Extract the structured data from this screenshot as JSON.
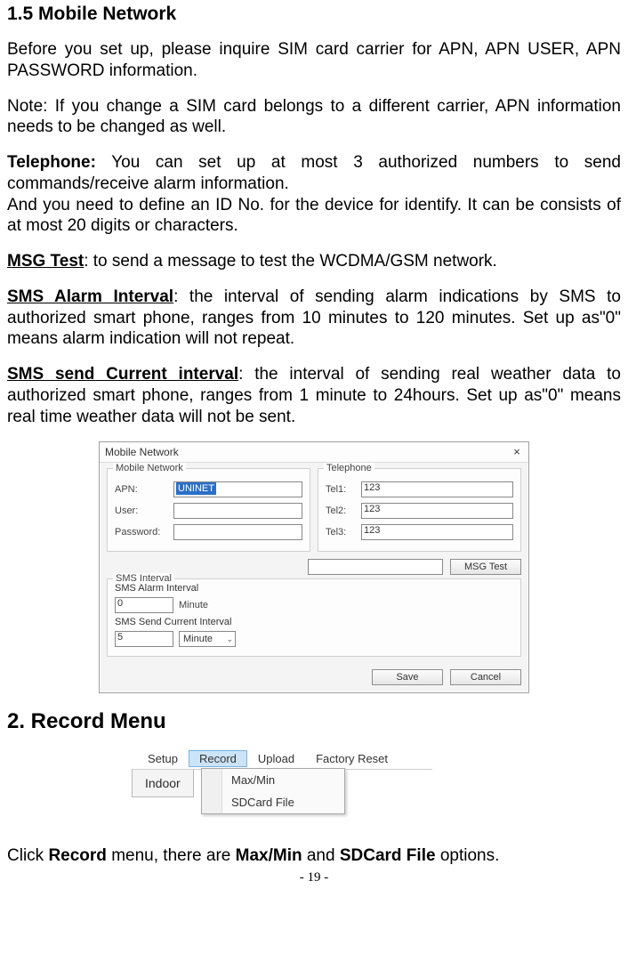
{
  "section15": {
    "heading": "1.5 Mobile Network",
    "p1": "Before you set up, please inquire SIM card carrier for APN, APN USER, APN PASSWORD information.",
    "p2": "Note: If you change a SIM card belongs to a different carrier, APN information needs to be changed as well.",
    "tel_label": "Telephone:",
    "tel_text": " You can set up at most 3 authorized numbers to send commands/receive alarm information.",
    "tel_text2": "And you need to define an ID No. for the device for identify. It can be consists of at most 20 digits or characters.",
    "msg_label": "MSG Test",
    "msg_text": ": to send a message to test the WCDMA/GSM network.",
    "sai_label": "SMS Alarm Interval",
    "sai_text": ": the interval of sending alarm indications by SMS to authorized smart phone, ranges from 10 minutes to 120 minutes.   Set up as\"0\" means alarm indication will not repeat.",
    "sci_label": "SMS send Current interval",
    "sci_text": ": the interval of sending real weather data to authorized smart phone, ranges from 1 minute to 24hours. Set up as\"0\" means real time weather data will not be sent."
  },
  "dialog": {
    "title": "Mobile Network",
    "close": "×",
    "group_mn": "Mobile Network",
    "group_tel": "Telephone",
    "apn_lbl": "APN:",
    "apn_val": "UNINET",
    "user_lbl": "User:",
    "user_val": "",
    "pw_lbl": "Password:",
    "pw_val": "",
    "tel1_lbl": "Tel1:",
    "tel1_val": "123",
    "tel2_lbl": "Tel2:",
    "tel2_val": "123",
    "tel3_lbl": "Tel3:",
    "tel3_val": "123",
    "sms_group": "SMS Interval",
    "sai_lbl": "SMS Alarm Interval",
    "sai_val": "0",
    "sai_unit": "Minute",
    "sci_lbl": "SMS Send Current Interval",
    "sci_val": "5",
    "sci_unit": "Minute",
    "msg_val": "",
    "msg_btn": "MSG Test",
    "save_btn": "Save",
    "cancel_btn": "Cancel"
  },
  "section2": {
    "heading": "2. Record Menu",
    "menu": {
      "setup": "Setup",
      "record": "Record",
      "upload": "Upload",
      "factory": "Factory Reset",
      "tab": "Indoor",
      "dd1": "Max/Min",
      "dd2": "SDCard File"
    },
    "caption_pre": "Click ",
    "caption_b1": "Record",
    "caption_mid": " menu, there are ",
    "caption_b2": "Max/Min",
    "caption_and": " and ",
    "caption_b3": "SDCard File",
    "caption_post": " options."
  },
  "pagenum": "- 19 -"
}
